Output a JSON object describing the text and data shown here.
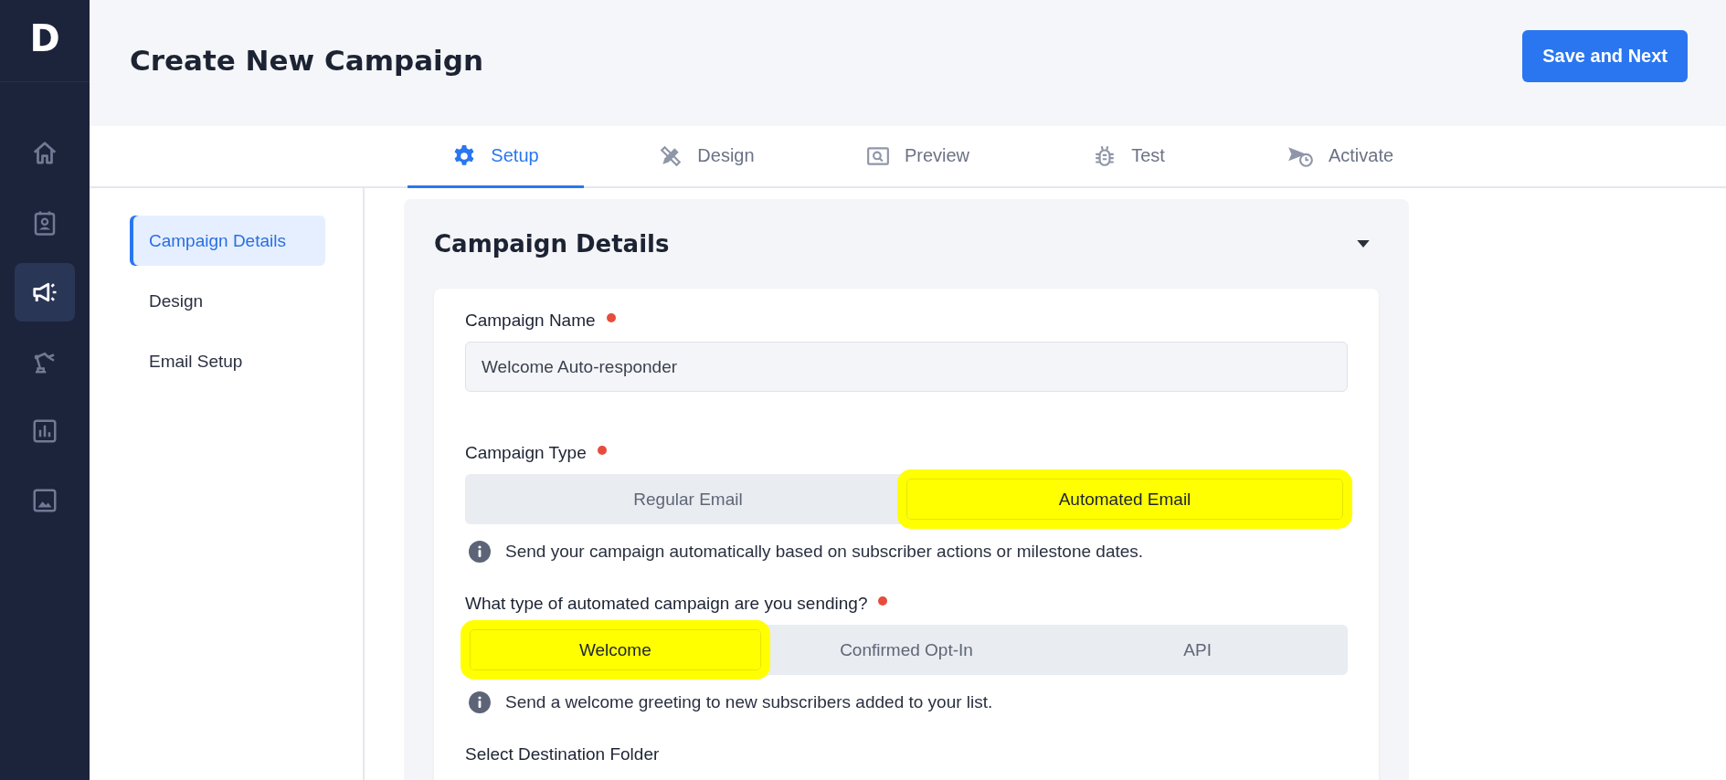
{
  "logo": {
    "letter": "D"
  },
  "nav": [
    {
      "selected": false
    },
    {
      "selected": false
    },
    {
      "selected": true
    },
    {
      "selected": false
    },
    {
      "selected": false
    },
    {
      "selected": false
    }
  ],
  "header": {
    "title": "Create New Campaign",
    "save_button": "Save and Next"
  },
  "tabs": [
    {
      "label": "Setup",
      "selected": true
    },
    {
      "label": "Design",
      "selected": false
    },
    {
      "label": "Preview",
      "selected": false
    },
    {
      "label": "Test",
      "selected": false
    },
    {
      "label": "Activate",
      "selected": false
    }
  ],
  "side_menu": [
    {
      "label": "Campaign Details",
      "selected": true
    },
    {
      "label": "Design",
      "selected": false
    },
    {
      "label": "Email Setup",
      "selected": false
    }
  ],
  "panel": {
    "title": "Campaign Details",
    "expanded": true,
    "fields": [
      {
        "kind": "text",
        "label": "Campaign Name",
        "required": true,
        "value": "Welcome Auto-responder"
      },
      {
        "kind": "segments",
        "label": "Campaign Type",
        "required": true,
        "options": [
          {
            "label": "Regular Email",
            "selected": false
          },
          {
            "label": "Automated Email",
            "selected": true
          }
        ],
        "info": "Send your campaign automatically based on subscriber actions or milestone dates."
      },
      {
        "kind": "segments",
        "label": "What type of automated campaign are you sending?",
        "required": true,
        "options": [
          {
            "label": "Welcome",
            "selected": true
          },
          {
            "label": "Confirmed Opt-In",
            "selected": false
          },
          {
            "label": "API",
            "selected": false
          }
        ],
        "info": "Send a welcome greeting to new subscribers added to your list."
      },
      {
        "kind": "label",
        "label": "Select Destination Folder",
        "required": false
      }
    ]
  }
}
